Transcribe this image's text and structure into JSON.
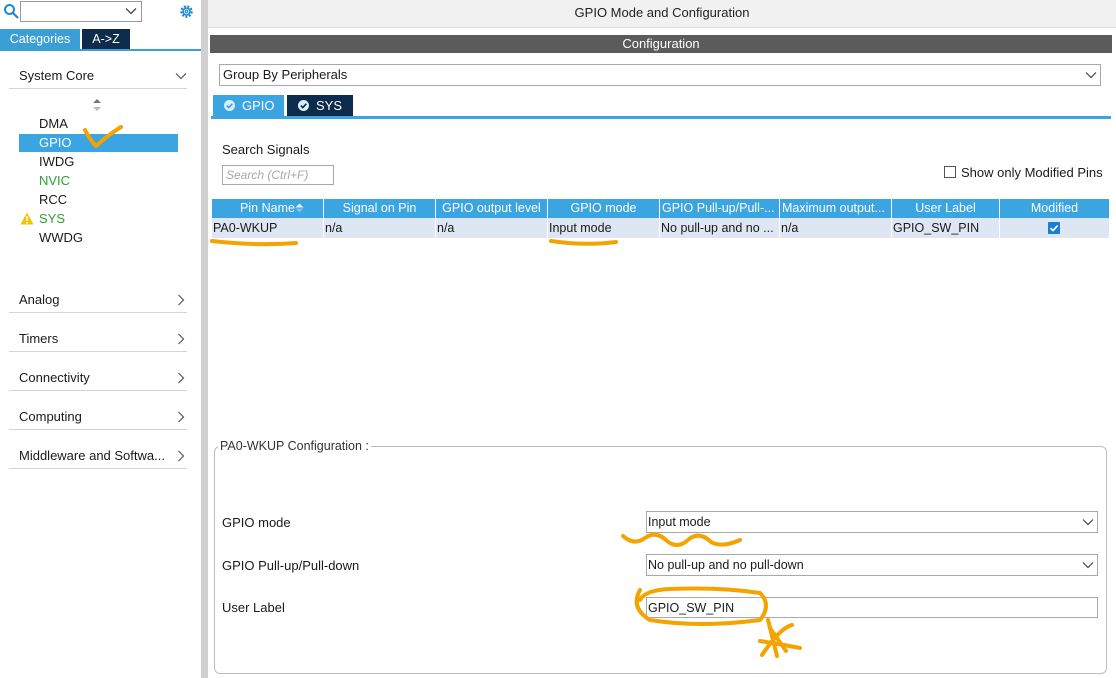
{
  "sidebar": {
    "tabs": {
      "categories": "Categories",
      "az": "A->Z"
    },
    "categories": [
      {
        "label": "System Core",
        "expanded": true
      },
      {
        "label": "Analog"
      },
      {
        "label": "Timers"
      },
      {
        "label": "Connectivity"
      },
      {
        "label": "Computing"
      },
      {
        "label": "Middleware and Softwa..."
      }
    ],
    "system_core_items": [
      "DMA",
      "GPIO",
      "IWDG",
      "NVIC",
      "RCC",
      "SYS",
      "WWDG"
    ],
    "selected_item": "GPIO"
  },
  "header": {
    "title": "GPIO Mode and Configuration",
    "configuration": "Configuration"
  },
  "group_by": {
    "value": "Group By Peripherals"
  },
  "mode_tabs": [
    {
      "label": "GPIO",
      "active": true
    },
    {
      "label": "SYS",
      "active": false
    }
  ],
  "signals": {
    "search_label": "Search Signals",
    "search_placeholder": "Search (Ctrl+F)",
    "show_modified_label": "Show only Modified Pins",
    "show_modified_checked": false
  },
  "table": {
    "columns": [
      "Pin Name",
      "Signal on Pin",
      "GPIO output level",
      "GPIO mode",
      "GPIO Pull-up/Pull-...",
      "Maximum output...",
      "User Label",
      "Modified"
    ],
    "rows": [
      {
        "pin_name": "PA0-WKUP",
        "signal": "n/a",
        "output_level": "n/a",
        "mode": "Input mode",
        "pull": "No pull-up and no ...",
        "max_output": "n/a",
        "user_label": "GPIO_SW_PIN",
        "modified": true
      }
    ]
  },
  "pin_config": {
    "title": "PA0-WKUP Configuration :",
    "gpio_mode_label": "GPIO mode",
    "gpio_mode_value": "Input mode",
    "pull_label": "GPIO Pull-up/Pull-down",
    "pull_value": "No pull-up and no pull-down",
    "user_label_label": "User Label",
    "user_label_value": "GPIO_SW_PIN"
  },
  "colors": {
    "accent": "#3aa5e0",
    "dark_tab": "#0d2b4a",
    "annotation": "#f5a300",
    "valid_green": "#2ca02c"
  }
}
